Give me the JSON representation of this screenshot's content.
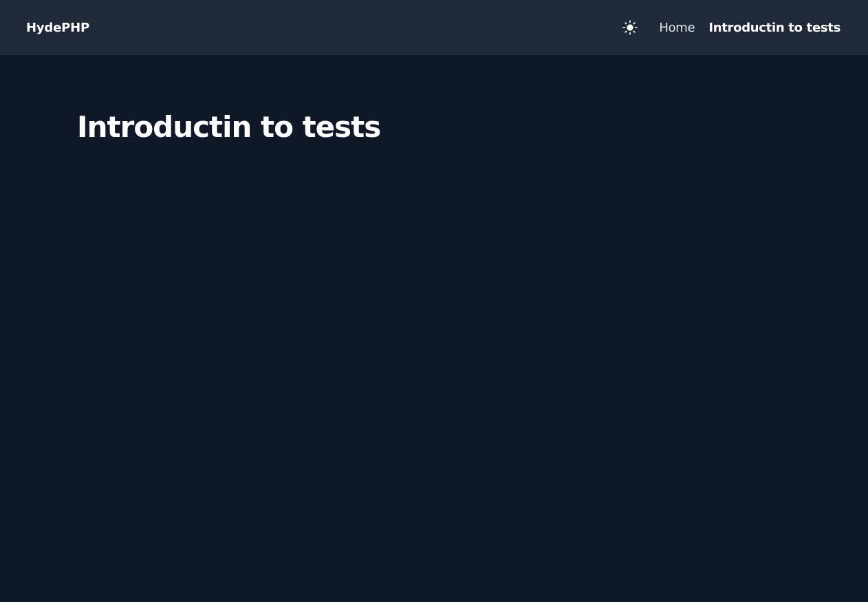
{
  "navbar": {
    "brand": "HydePHP",
    "theme_toggle_icon": "sun-icon",
    "links": [
      {
        "label": "Home",
        "active": false
      },
      {
        "label": "Introductin to tests",
        "active": true
      }
    ]
  },
  "main": {
    "title": "Introductin to tests"
  },
  "colors": {
    "page_background": "#111827",
    "navbar_background": "#1f2937",
    "text": "#ffffff"
  }
}
